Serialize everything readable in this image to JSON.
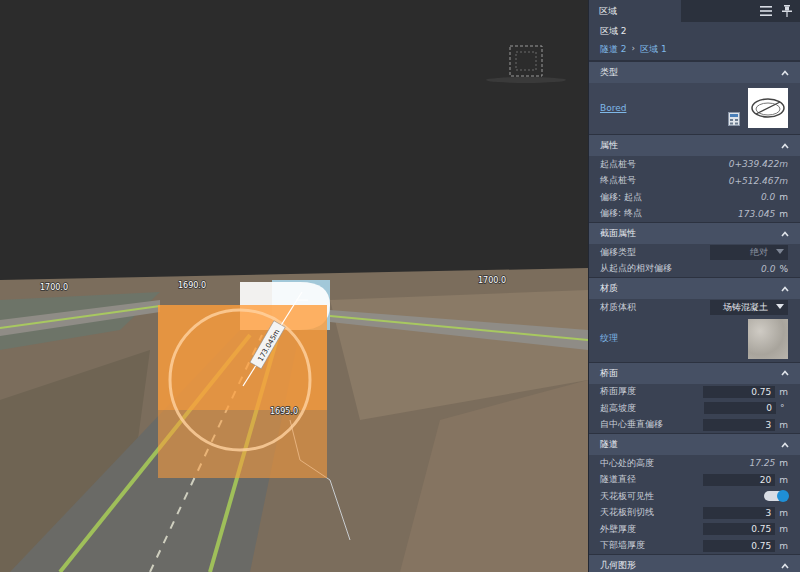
{
  "viewport": {
    "station_labels": [
      "1700.0",
      "1690.0",
      "1700.0",
      "1695.0"
    ],
    "dimension_label": "173.045m"
  },
  "panel": {
    "tab": "区域",
    "title": "区域 2",
    "breadcrumb": [
      "隧道 2",
      "区域 1"
    ],
    "breadcrumb_separator": "›",
    "sections": [
      {
        "title": "类型",
        "expanded": true,
        "rows": [
          {
            "kind": "type",
            "label": "Bored"
          }
        ]
      },
      {
        "title": "属性",
        "expanded": true,
        "rows": [
          {
            "kind": "static",
            "label": "起点桩号",
            "value": "0+339.422m",
            "unit": ""
          },
          {
            "kind": "static",
            "label": "终点桩号",
            "value": "0+512.467m",
            "unit": ""
          },
          {
            "kind": "static",
            "label": "偏移: 起点",
            "value": "0.0",
            "unit": "m"
          },
          {
            "kind": "static",
            "label": "偏移: 终点",
            "value": "173.045",
            "unit": "m"
          }
        ]
      },
      {
        "title": "截面属性",
        "expanded": true,
        "rows": [
          {
            "kind": "dropdown",
            "label": "偏移类型",
            "value": "绝对",
            "disabled": true
          },
          {
            "kind": "static",
            "label": "从起点的相对偏移",
            "value": "0.0",
            "unit": "%"
          }
        ]
      },
      {
        "title": "材质",
        "expanded": true,
        "rows": [
          {
            "kind": "dropdown",
            "label": "材质体积",
            "value": "场铸混凝土",
            "disabled": false
          },
          {
            "kind": "texture",
            "label": "纹理"
          }
        ]
      },
      {
        "title": "桥面",
        "expanded": true,
        "rows": [
          {
            "kind": "input",
            "label": "桥面厚度",
            "value": "0.75",
            "unit": "m"
          },
          {
            "kind": "input",
            "label": "超高坡度",
            "value": "0",
            "unit": "°"
          },
          {
            "kind": "input",
            "label": "自中心垂直偏移",
            "value": "3",
            "unit": "m"
          }
        ]
      },
      {
        "title": "隧道",
        "expanded": true,
        "rows": [
          {
            "kind": "static",
            "label": "中心处的高度",
            "value": "17.25",
            "unit": "m"
          },
          {
            "kind": "input",
            "label": "隧道直径",
            "value": "20",
            "unit": "m"
          },
          {
            "kind": "toggle",
            "label": "天花板可见性",
            "on": true
          },
          {
            "kind": "input",
            "label": "天花板剖切线",
            "value": "3",
            "unit": "m"
          },
          {
            "kind": "input",
            "label": "外壁厚度",
            "value": "0.75",
            "unit": "m"
          },
          {
            "kind": "input",
            "label": "下部墙厚度",
            "value": "0.75",
            "unit": "m"
          }
        ]
      },
      {
        "title": "几何图形",
        "expanded": true,
        "rows": []
      }
    ]
  }
}
